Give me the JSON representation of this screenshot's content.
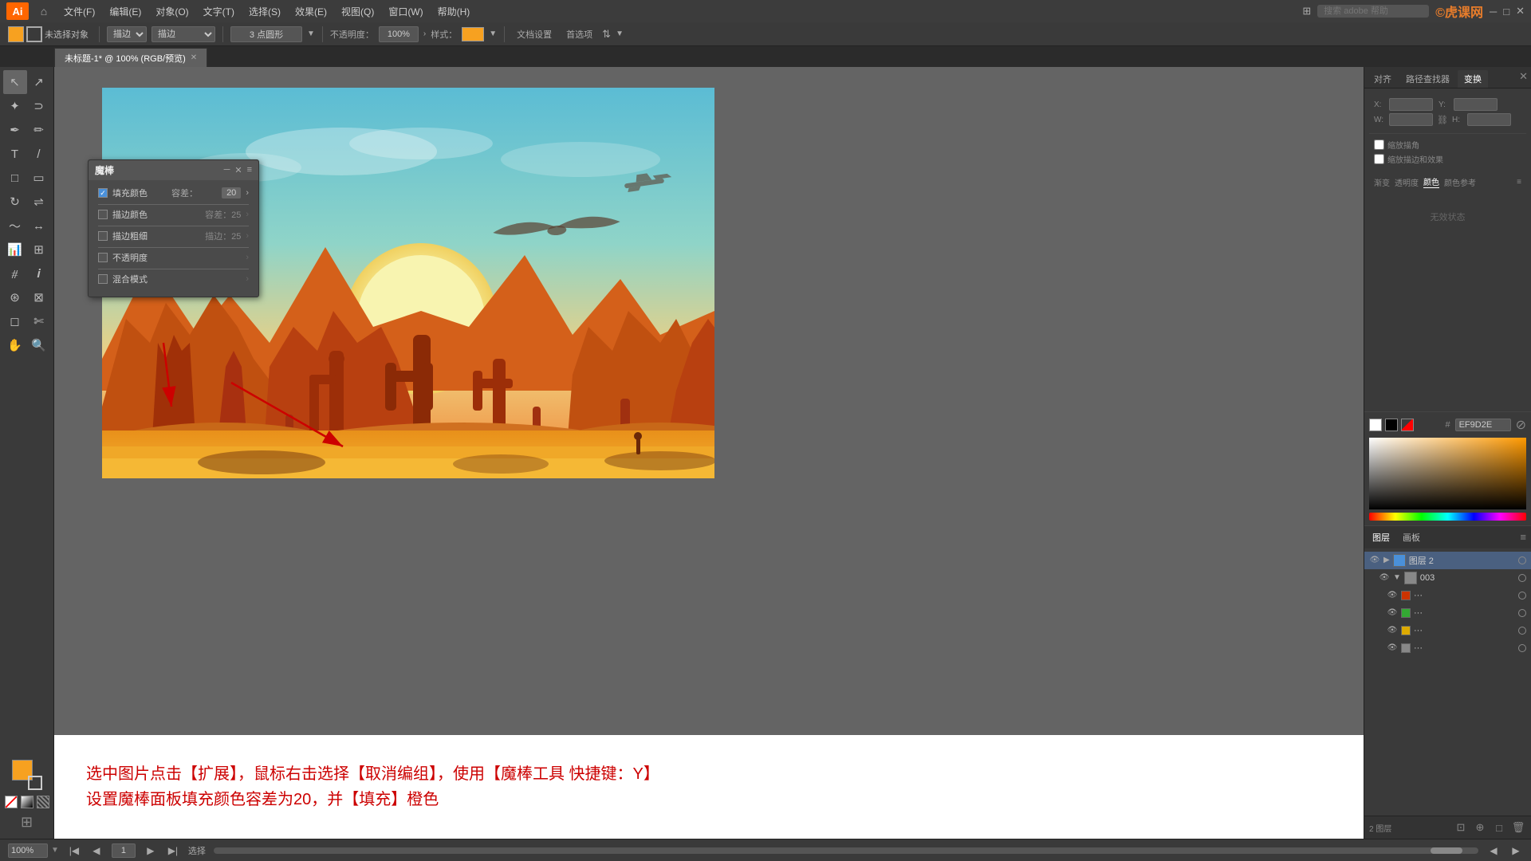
{
  "app": {
    "title": "Adobe Illustrator",
    "logo": "Ai"
  },
  "menu": {
    "items": [
      "文件(F)",
      "编辑(E)",
      "对象(O)",
      "文字(T)",
      "选择(S)",
      "效果(E)",
      "视图(Q)",
      "窗口(W)",
      "帮助(H)"
    ]
  },
  "toolbar": {
    "fill_label": "未选择对象",
    "stroke_label": "描边：",
    "mode_label": "描边",
    "brush_size": "3 点圆形",
    "opacity_label": "不透明度：",
    "opacity_value": "100%",
    "style_label": "样式：",
    "doc_settings": "文档设置",
    "preferences": "首选项"
  },
  "tab": {
    "title": "未标题-1*",
    "subtitle": "100% (RGB/预览)"
  },
  "magic_wand": {
    "title": "魔棒",
    "fill_color": "填充颜色",
    "fill_tolerance_label": "容差：",
    "fill_tolerance_value": "20",
    "stroke_color": "描边颜色",
    "stroke_tolerance": "容差：25",
    "stroke_weight": "描边粗细",
    "stroke_weight_val": "描边：25",
    "opacity": "不透明度",
    "blend_mode": "混合模式",
    "opacity_val": "",
    "blend_val": ""
  },
  "annotation": {
    "line1": "选中图片点击【扩展】，鼠标右击选择【取消编组】，使用【魔棒工具 快捷键：Y】",
    "line2": "设置魔棒面板填充颜色容差为20，并【填充】橙色"
  },
  "right_panel": {
    "tabs": [
      "对齐",
      "路径查找器",
      "变换"
    ],
    "active_tab": "变换",
    "no_selection": "无效状态",
    "color_section": {
      "tabs": [
        "渐变",
        "透明度",
        "颜色",
        "颜色参考"
      ],
      "active": "颜色",
      "hex_label": "#",
      "hex_value": "EF9D2E",
      "white_swatch": "#ffffff",
      "black_swatch": "#000000"
    }
  },
  "layers": {
    "tabs": [
      "图层",
      "画板"
    ],
    "active": "图层",
    "items": [
      {
        "name": "图层 2",
        "visible": true,
        "expanded": true,
        "color": "#4a90d9"
      },
      {
        "name": "003",
        "visible": true,
        "indent": true,
        "color": "#888"
      },
      {
        "name": "...",
        "visible": true,
        "swatch": "#cc3300",
        "indent": true
      },
      {
        "name": "...",
        "visible": true,
        "swatch": "#33aa33",
        "indent": true
      },
      {
        "name": "...",
        "visible": true,
        "swatch": "#ddaa00",
        "indent": true
      },
      {
        "name": "...",
        "visible": true,
        "swatch": "#888888",
        "indent": true
      }
    ],
    "bottom_text": "2 图层"
  },
  "status_bar": {
    "zoom": "100%",
    "page": "1",
    "action": "选择"
  },
  "watermark": "©虎课网"
}
